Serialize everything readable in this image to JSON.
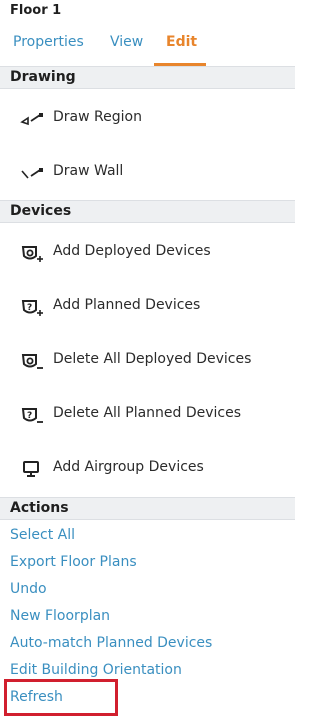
{
  "panel": {
    "title": "Floor 1"
  },
  "tabs": [
    {
      "label": "Properties",
      "active": false
    },
    {
      "label": "View",
      "active": false
    },
    {
      "label": "Edit",
      "active": true
    }
  ],
  "drawing": {
    "header": "Drawing",
    "items": [
      {
        "label": "Draw Region",
        "icon": "draw-region-icon"
      },
      {
        "label": "Draw Wall",
        "icon": "draw-wall-icon"
      }
    ]
  },
  "devices": {
    "header": "Devices",
    "items": [
      {
        "label": "Add Deployed Devices",
        "icon": "add-deployed-device-icon"
      },
      {
        "label": "Add Planned Devices",
        "icon": "add-planned-device-icon"
      },
      {
        "label": "Delete All Deployed Devices",
        "icon": "delete-deployed-device-icon"
      },
      {
        "label": "Delete All Planned Devices",
        "icon": "delete-planned-device-icon"
      },
      {
        "label": "Add Airgroup Devices",
        "icon": "monitor-icon"
      }
    ]
  },
  "actions": {
    "header": "Actions",
    "items": [
      "Select All",
      "Export Floor Plans",
      "Undo",
      "New Floorplan",
      "Auto-match Planned Devices",
      "Edit Building Orientation",
      "Refresh"
    ],
    "highlighted": "Refresh"
  },
  "colors": {
    "link": "#3a8fc0",
    "active_tab": "#e8852c",
    "highlight": "#d11f2e",
    "section_bg": "#eef0f2"
  }
}
